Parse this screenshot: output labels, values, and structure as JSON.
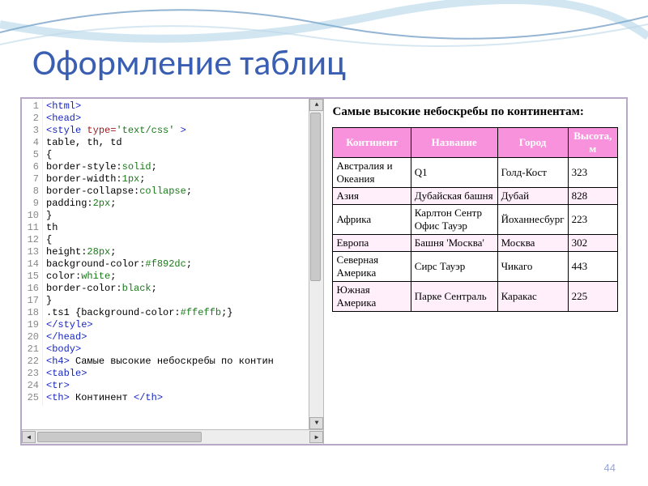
{
  "title": "Оформление таблиц",
  "page_number": "44",
  "code": {
    "lines": [
      [
        [
          "tag",
          "<html>"
        ]
      ],
      [
        [
          "tag",
          "<head>"
        ]
      ],
      [
        [
          "tag",
          "<style "
        ],
        [
          "attr",
          "type="
        ],
        [
          "str",
          "'text/css'"
        ],
        [
          "tag",
          " >"
        ]
      ],
      [
        [
          "txt",
          "table, th, td"
        ]
      ],
      [
        [
          "txt",
          "{"
        ]
      ],
      [
        [
          "txt",
          "border-style:"
        ],
        [
          "str",
          "solid"
        ],
        [
          "txt",
          ";"
        ]
      ],
      [
        [
          "txt",
          "border-width:"
        ],
        [
          "str",
          "1px"
        ],
        [
          "txt",
          ";"
        ]
      ],
      [
        [
          "txt",
          "border-collapse:"
        ],
        [
          "str",
          "collapse"
        ],
        [
          "txt",
          ";"
        ]
      ],
      [
        [
          "txt",
          "padding:"
        ],
        [
          "str",
          "2px"
        ],
        [
          "txt",
          ";"
        ]
      ],
      [
        [
          "txt",
          "}"
        ]
      ],
      [
        [
          "txt",
          "th"
        ]
      ],
      [
        [
          "txt",
          "{"
        ]
      ],
      [
        [
          "txt",
          "height:"
        ],
        [
          "str",
          "28px"
        ],
        [
          "txt",
          ";"
        ]
      ],
      [
        [
          "txt",
          "background-color:"
        ],
        [
          "str",
          "#f892dc"
        ],
        [
          "txt",
          ";"
        ]
      ],
      [
        [
          "txt",
          "color:"
        ],
        [
          "str",
          "white"
        ],
        [
          "txt",
          ";"
        ]
      ],
      [
        [
          "txt",
          "border-color:"
        ],
        [
          "str",
          "black"
        ],
        [
          "txt",
          ";"
        ]
      ],
      [
        [
          "txt",
          "}"
        ]
      ],
      [
        [
          "txt",
          ".ts1 {background-color:"
        ],
        [
          "str",
          "#ffeffb"
        ],
        [
          "txt",
          ";}"
        ]
      ],
      [
        [
          "tag",
          "</style>"
        ]
      ],
      [
        [
          "tag",
          "</head>"
        ]
      ],
      [
        [
          "tag",
          "<body>"
        ]
      ],
      [
        [
          "tag",
          "<h4>"
        ],
        [
          "txt",
          " Самые высокие небоскребы по контин"
        ]
      ],
      [
        [
          "tag",
          "<table>"
        ]
      ],
      [
        [
          "tag",
          "<tr>"
        ]
      ],
      [
        [
          "tag",
          "<th>"
        ],
        [
          "txt",
          " Континент "
        ],
        [
          "tag",
          "</th>"
        ]
      ]
    ]
  },
  "preview": {
    "heading": "Самые высокие небоскребы по континентам:",
    "columns": [
      "Континент",
      "Название",
      "Город",
      "Высота, м"
    ],
    "rows": [
      {
        "alt": false,
        "cells": [
          "Австралия и Океания",
          "Q1",
          "Голд-Кост",
          "323"
        ]
      },
      {
        "alt": true,
        "cells": [
          "Азия",
          "Дубайская башня",
          "Дубай",
          "828"
        ]
      },
      {
        "alt": false,
        "cells": [
          "Африка",
          "Карлтон Сентр Офис Тауэр",
          "Йоханнесбург",
          "223"
        ]
      },
      {
        "alt": true,
        "cells": [
          "Европа",
          "Башня 'Москва'",
          "Москва",
          "302"
        ]
      },
      {
        "alt": false,
        "cells": [
          "Северная Америка",
          "Сирс Тауэр",
          "Чикаго",
          "443"
        ]
      },
      {
        "alt": true,
        "cells": [
          "Южная Америка",
          "Парке Сентраль",
          "Каракас",
          "225"
        ]
      }
    ]
  },
  "chart_data": {
    "type": "table",
    "title": "Самые высокие небоскребы по континентам",
    "columns": [
      "Континент",
      "Название",
      "Город",
      "Высота, м"
    ],
    "rows": [
      [
        "Австралия и Океания",
        "Q1",
        "Голд-Кост",
        323
      ],
      [
        "Азия",
        "Дубайская башня",
        "Дубай",
        828
      ],
      [
        "Африка",
        "Карлтон Сентр Офис Тауэр",
        "Йоханнесбург",
        223
      ],
      [
        "Европа",
        "Башня 'Москва'",
        "Москва",
        302
      ],
      [
        "Северная Америка",
        "Сирс Тауэр",
        "Чикаго",
        443
      ],
      [
        "Южная Америка",
        "Парке Сентраль",
        "Каракас",
        225
      ]
    ]
  }
}
